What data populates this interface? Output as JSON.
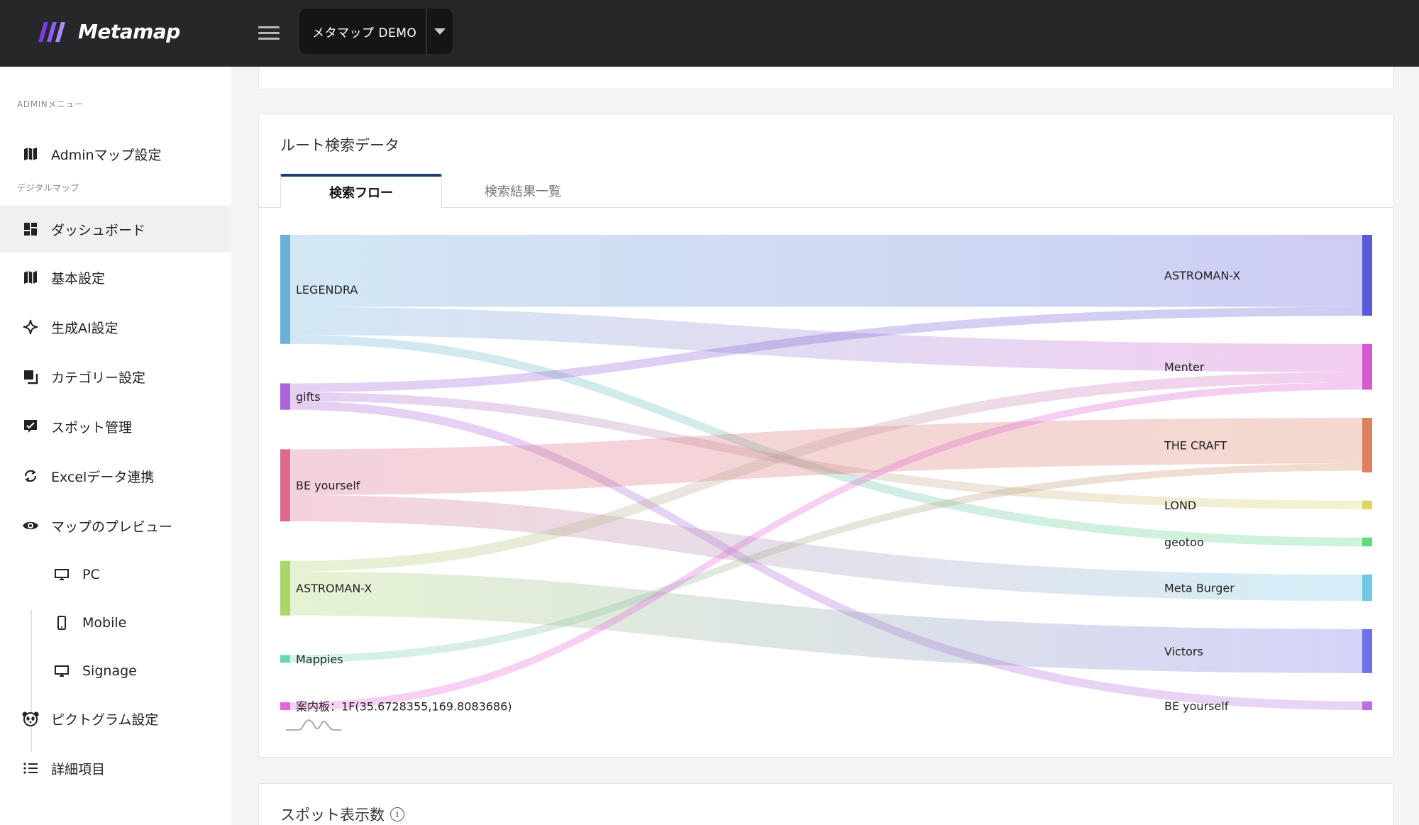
{
  "app": {
    "logo_text": "Metamap",
    "project_name": "メタマップ DEMO"
  },
  "sidebar": {
    "section_admin": "ADMINメニュー",
    "admin_items": [
      {
        "label": "Adminマップ設定",
        "icon": "map-icon"
      }
    ],
    "section_digital": "デジタルマップ",
    "items": [
      {
        "label": "ダッシュボード",
        "icon": "dashboard-icon",
        "active": true
      },
      {
        "label": "基本設定",
        "icon": "map-icon"
      },
      {
        "label": "生成AI設定",
        "icon": "sparkle-icon"
      },
      {
        "label": "カテゴリー設定",
        "icon": "category-icon"
      },
      {
        "label": "スポット管理",
        "icon": "spot-icon"
      },
      {
        "label": "Excelデータ連携",
        "icon": "sync-icon"
      },
      {
        "label": "マップのプレビュー",
        "icon": "eye-icon"
      }
    ],
    "preview_items": [
      {
        "label": "PC",
        "icon": "monitor-icon"
      },
      {
        "label": "Mobile",
        "icon": "mobile-icon"
      },
      {
        "label": "Signage",
        "icon": "monitor-icon"
      }
    ],
    "bottom_items": [
      {
        "label": "ピクトグラム設定",
        "icon": "panda-icon"
      },
      {
        "label": "詳細項目",
        "icon": "list-icon"
      }
    ]
  },
  "route_card": {
    "title": "ルート検索データ",
    "tabs": [
      {
        "label": "検索フロー",
        "active": true
      },
      {
        "label": "検索結果一覧",
        "active": false
      }
    ]
  },
  "spot_card": {
    "title": "スポット表示数"
  },
  "colors": {
    "topbar": "#27272a",
    "tab_accent": "#1f3f70",
    "logo_purple": "#7c3aed"
  },
  "chart_data": {
    "type": "sankey",
    "sources": [
      {
        "name": "LEGENDRA",
        "value": 124,
        "color": "#6ab0d8"
      },
      {
        "name": "gifts",
        "value": 30,
        "color": "#a864d8"
      },
      {
        "name": "BE yourself",
        "value": 82,
        "color": "#dc6a8c"
      },
      {
        "name": "ASTROMAN-X",
        "value": 62,
        "color": "#a8d86a"
      },
      {
        "name": "Mappies",
        "value": 8,
        "color": "#6ad8b8"
      },
      {
        "name": "案内板：1F(35.6728355,169.8083686)",
        "value": 8,
        "color": "#e864d8"
      }
    ],
    "targets": [
      {
        "name": "ASTROMAN-X",
        "value": 92,
        "color": "#5a5ad8"
      },
      {
        "name": "Menter",
        "value": 52,
        "color": "#d85ad0"
      },
      {
        "name": "THE CRAFT",
        "value": 62,
        "color": "#dc8060"
      },
      {
        "name": "LOND",
        "value": 10,
        "color": "#d8d860"
      },
      {
        "name": "geotoo",
        "value": 10,
        "color": "#60d880"
      },
      {
        "name": "Meta Burger",
        "value": 30,
        "color": "#70c8e8"
      },
      {
        "name": "Victors",
        "value": 50,
        "color": "#7070e8"
      },
      {
        "name": "BE yourself",
        "value": 10,
        "color": "#b870e0"
      }
    ],
    "links": [
      {
        "source": "LEGENDRA",
        "target": "ASTROMAN-X",
        "value": 82
      },
      {
        "source": "LEGENDRA",
        "target": "Menter",
        "value": 32
      },
      {
        "source": "LEGENDRA",
        "target": "geotoo",
        "value": 10
      },
      {
        "source": "gifts",
        "target": "ASTROMAN-X",
        "value": 10
      },
      {
        "source": "gifts",
        "target": "LOND",
        "value": 10
      },
      {
        "source": "gifts",
        "target": "BE yourself",
        "value": 10
      },
      {
        "source": "BE yourself",
        "target": "THE CRAFT",
        "value": 52
      },
      {
        "source": "BE yourself",
        "target": "Meta Burger",
        "value": 30
      },
      {
        "source": "ASTROMAN-X",
        "target": "Menter",
        "value": 12
      },
      {
        "source": "ASTROMAN-X",
        "target": "Victors",
        "value": 50
      },
      {
        "source": "Mappies",
        "target": "THE CRAFT",
        "value": 8
      },
      {
        "source": "案内板：1F(35.6728355,169.8083686)",
        "target": "Menter",
        "value": 8
      }
    ]
  }
}
